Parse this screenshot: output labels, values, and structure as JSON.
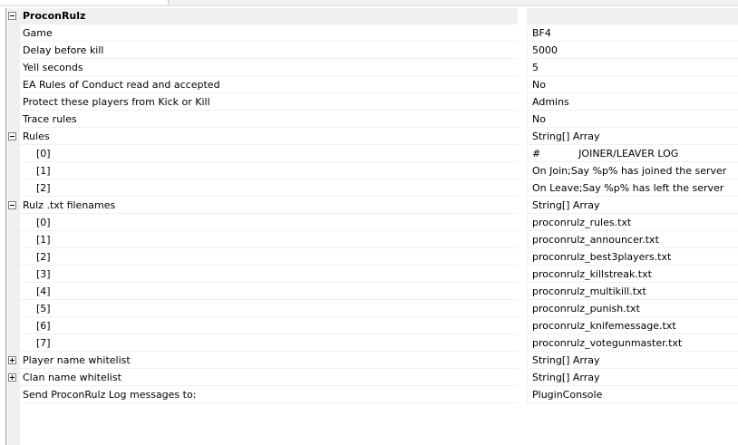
{
  "category": {
    "label": "ProconRulz"
  },
  "rows": [
    {
      "name": "Game",
      "value": "BF4"
    },
    {
      "name": "Delay before kill",
      "value": "5000"
    },
    {
      "name": "Yell seconds",
      "value": "5"
    },
    {
      "name": "EA Rules of Conduct read and accepted",
      "value": "No"
    },
    {
      "name": "Protect these players from Kick or Kill",
      "value": "Admins"
    },
    {
      "name": "Trace rules",
      "value": "No"
    }
  ],
  "rules": {
    "name": "Rules",
    "value": "String[] Array",
    "expanded": true,
    "items": [
      {
        "index": "[0]",
        "value": "#            JOINER/LEAVER LOG"
      },
      {
        "index": "[1]",
        "value": "On Join;Say %p% has joined the server"
      },
      {
        "index": "[2]",
        "value": "On Leave;Say %p% has left the server"
      }
    ]
  },
  "filenames": {
    "name": "Rulz .txt filenames",
    "value": "String[] Array",
    "expanded": true,
    "items": [
      {
        "index": "[0]",
        "value": "proconrulz_rules.txt"
      },
      {
        "index": "[1]",
        "value": "proconrulz_announcer.txt"
      },
      {
        "index": "[2]",
        "value": "proconrulz_best3players.txt"
      },
      {
        "index": "[3]",
        "value": "proconrulz_killstreak.txt"
      },
      {
        "index": "[4]",
        "value": "proconrulz_multikill.txt"
      },
      {
        "index": "[5]",
        "value": "proconrulz_punish.txt"
      },
      {
        "index": "[6]",
        "value": "proconrulz_knifemessage.txt"
      },
      {
        "index": "[7]",
        "value": "proconrulz_votegunmaster.txt"
      }
    ]
  },
  "player_whitelist": {
    "name": "Player name whitelist",
    "value": "String[] Array",
    "expanded": false
  },
  "clan_whitelist": {
    "name": "Clan name whitelist",
    "value": "String[] Array",
    "expanded": false
  },
  "log_target": {
    "name": "Send ProconRulz Log messages to:",
    "value": "PluginConsole"
  },
  "colors": {
    "category_bg": "#f0f0f0",
    "grid_line": "#f0f0f0",
    "border": "#a0a0a0"
  }
}
